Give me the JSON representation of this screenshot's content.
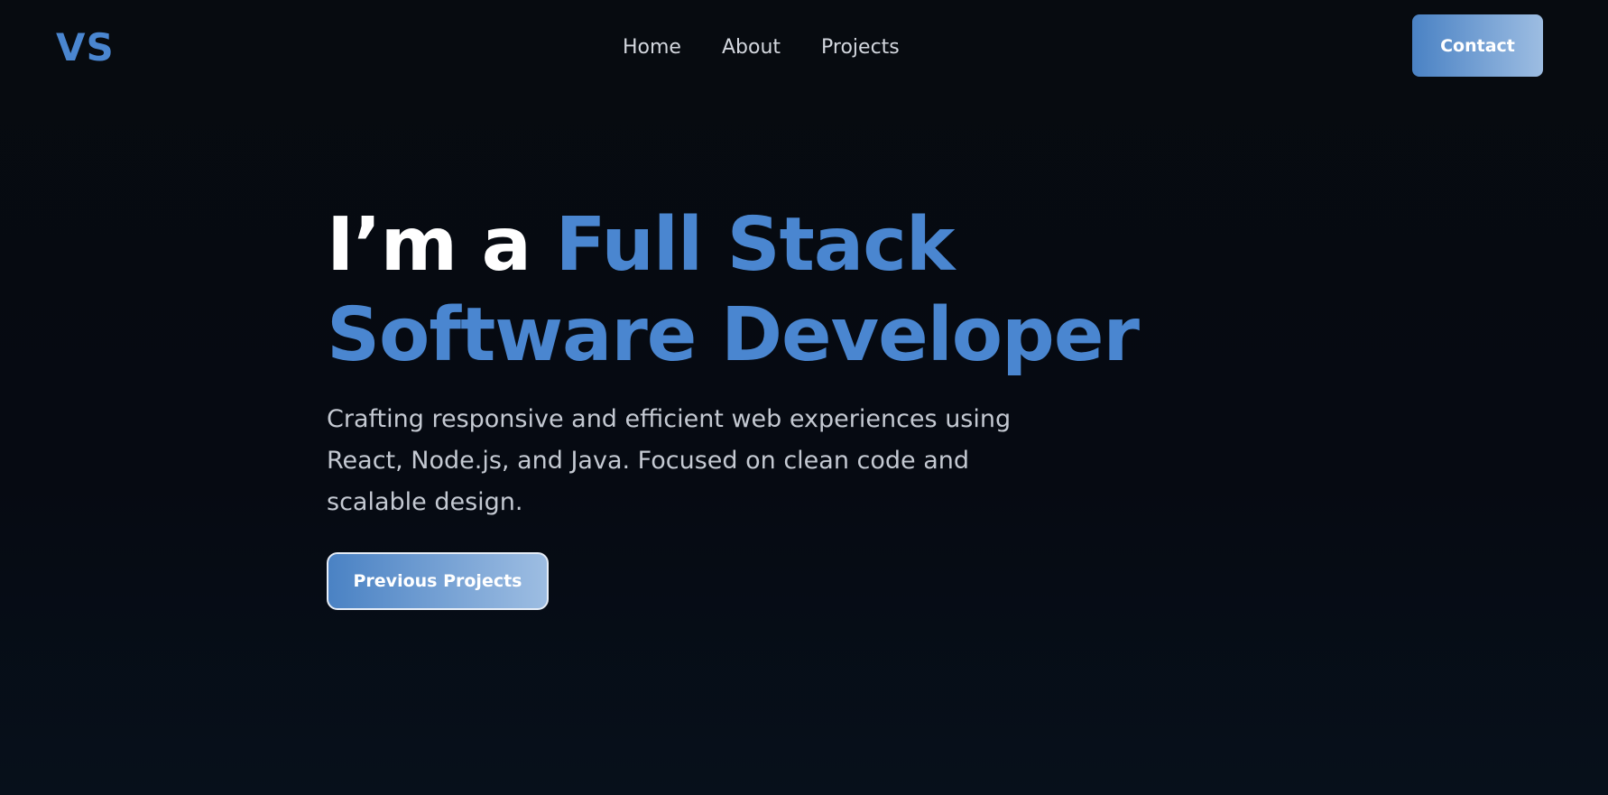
{
  "nav": {
    "logo": "VS",
    "links": [
      {
        "label": "Home"
      },
      {
        "label": "About"
      },
      {
        "label": "Projects"
      }
    ],
    "contact_label": "Contact"
  },
  "hero": {
    "title_plain": "I’m a ",
    "title_accent": "Full Stack Software Developer",
    "subtitle": "Crafting responsive and efficient web experiences using React, Node.js, and Java. Focused on clean code and scalable design.",
    "cta_label": "Previous Projects"
  },
  "colors": {
    "background": "#070b12",
    "accent": "#4a86d0",
    "button_gradient_start": "#4a82c4",
    "button_gradient_end": "#9dbde2",
    "nav_text": "#d3d7de",
    "subtitle_text": "#c4c9d2"
  }
}
